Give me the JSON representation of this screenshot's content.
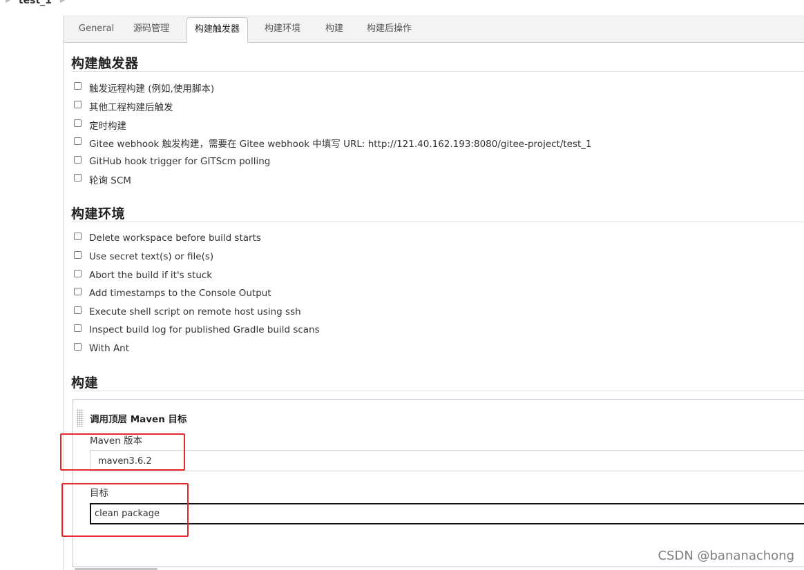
{
  "breadcrumb": {
    "project": "test_1"
  },
  "tabs": [
    {
      "label": "General"
    },
    {
      "label": "源码管理"
    },
    {
      "label": "构建触发器",
      "active": true
    },
    {
      "label": "构建环境"
    },
    {
      "label": "构建"
    },
    {
      "label": "构建后操作"
    }
  ],
  "triggers": {
    "title": "构建触发器",
    "options": [
      {
        "label": "触发远程构建 (例如,使用脚本)",
        "checked": false
      },
      {
        "label": "其他工程构建后触发",
        "checked": false
      },
      {
        "label": "定时构建",
        "checked": false
      },
      {
        "label": "Gitee webhook 触发构建，需要在 Gitee webhook 中填写 URL: http://121.40.162.193:8080/gitee-project/test_1",
        "checked": false
      },
      {
        "label": "GitHub hook trigger for GITScm polling",
        "checked": false
      },
      {
        "label": "轮询 SCM",
        "checked": false
      }
    ]
  },
  "environment": {
    "title": "构建环境",
    "options": [
      {
        "label": "Delete workspace before build starts",
        "checked": false
      },
      {
        "label": "Use secret text(s) or file(s)",
        "checked": false
      },
      {
        "label": "Abort the build if it's stuck",
        "checked": false
      },
      {
        "label": "Add timestamps to the Console Output",
        "checked": false
      },
      {
        "label": "Execute shell script on remote host using ssh",
        "checked": false
      },
      {
        "label": "Inspect build log for published Gradle build scans",
        "checked": false
      },
      {
        "label": "With Ant",
        "checked": false
      }
    ]
  },
  "build": {
    "title": "构建",
    "step_title": "调用顶层 Maven 目标",
    "maven_label": "Maven 版本",
    "maven_value": "maven3.6.2",
    "goals_label": "目标",
    "goals_value": "clean package"
  },
  "colors": {
    "annotation": "#e8262b",
    "tabbar": "#f2f3f5"
  },
  "watermark": "CSDN @bananachong"
}
